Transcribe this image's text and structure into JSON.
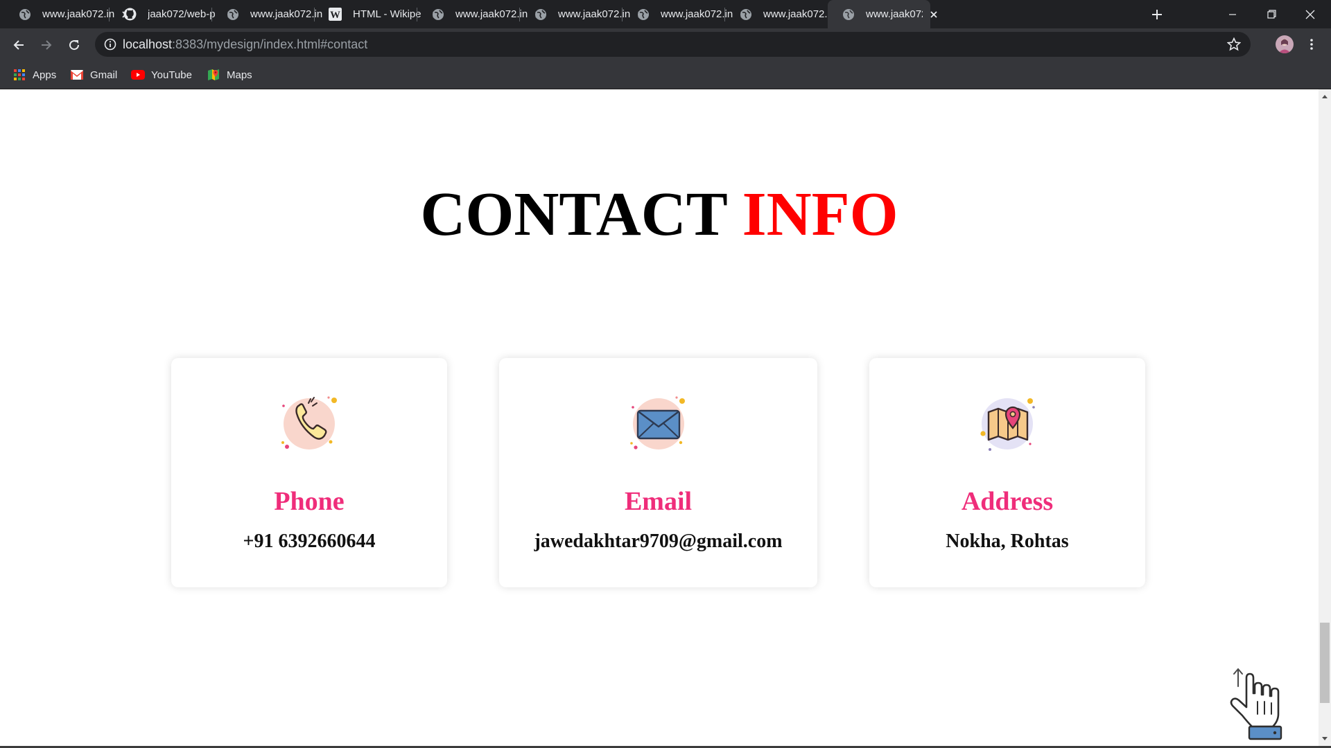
{
  "browser": {
    "tabs": [
      {
        "title": "www.jaak072.in",
        "icon": "globe-icon",
        "active": false
      },
      {
        "title": "jaak072/web-p",
        "icon": "github-icon",
        "active": false
      },
      {
        "title": "www.jaak072.in",
        "icon": "globe-icon",
        "active": false
      },
      {
        "title": "HTML - Wikipe",
        "icon": "wikipedia-icon",
        "active": false
      },
      {
        "title": "www.jaak072.in",
        "icon": "globe-icon",
        "active": false
      },
      {
        "title": "www.jaak072.in",
        "icon": "globe-icon",
        "active": false
      },
      {
        "title": "www.jaak072.in",
        "icon": "globe-icon",
        "active": false
      },
      {
        "title": "www.jaak072.in",
        "icon": "globe-icon",
        "active": false
      },
      {
        "title": "www.jaak072.in",
        "icon": "globe-icon",
        "active": true
      }
    ],
    "url_host": "localhost",
    "url_rest": ":8383/mydesign/index.html#contact",
    "bookmarks": [
      {
        "label": "Apps",
        "icon": "apps-grid-icon"
      },
      {
        "label": "Gmail",
        "icon": "gmail-icon"
      },
      {
        "label": "YouTube",
        "icon": "youtube-icon"
      },
      {
        "label": "Maps",
        "icon": "maps-icon"
      }
    ]
  },
  "page": {
    "heading_main": "CONTACT",
    "heading_accent": "INFO",
    "accent_color": "#ff0000",
    "card_title_color": "#ef2d7a",
    "cards": [
      {
        "title": "Phone",
        "value": "+91 6392660644",
        "icon": "phone-icon"
      },
      {
        "title": "Email",
        "value": "jawedakhtar9709@gmail.com",
        "icon": "envelope-icon"
      },
      {
        "title": "Address",
        "value": "Nokha, Rohtas",
        "icon": "map-pin-icon"
      }
    ],
    "scroll_top_icon": "scroll-up-hand-icon"
  }
}
